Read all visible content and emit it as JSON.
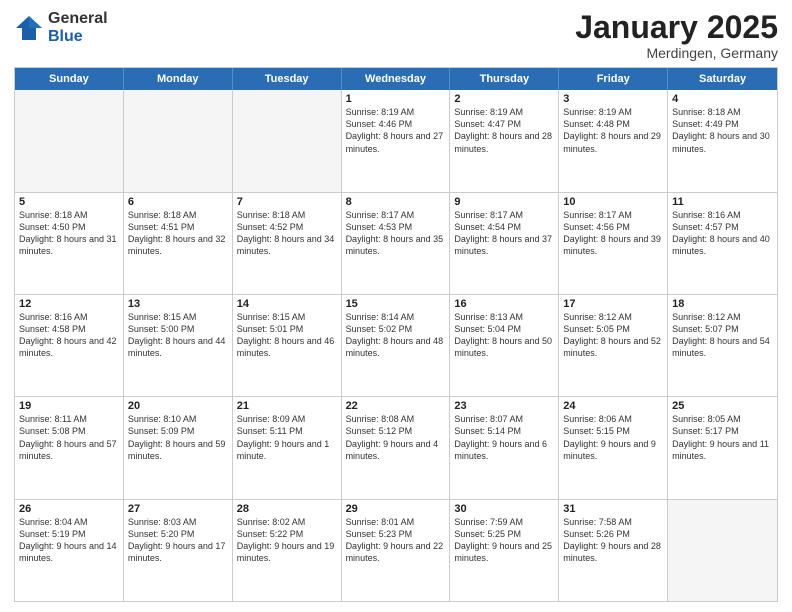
{
  "header": {
    "logo_general": "General",
    "logo_blue": "Blue",
    "month_title": "January 2025",
    "location": "Merdingen, Germany"
  },
  "weekdays": [
    "Sunday",
    "Monday",
    "Tuesday",
    "Wednesday",
    "Thursday",
    "Friday",
    "Saturday"
  ],
  "weeks": [
    [
      {
        "day": "",
        "info": "",
        "empty": true
      },
      {
        "day": "",
        "info": "",
        "empty": true
      },
      {
        "day": "",
        "info": "",
        "empty": true
      },
      {
        "day": "1",
        "info": "Sunrise: 8:19 AM\nSunset: 4:46 PM\nDaylight: 8 hours and 27 minutes."
      },
      {
        "day": "2",
        "info": "Sunrise: 8:19 AM\nSunset: 4:47 PM\nDaylight: 8 hours and 28 minutes."
      },
      {
        "day": "3",
        "info": "Sunrise: 8:19 AM\nSunset: 4:48 PM\nDaylight: 8 hours and 29 minutes."
      },
      {
        "day": "4",
        "info": "Sunrise: 8:18 AM\nSunset: 4:49 PM\nDaylight: 8 hours and 30 minutes."
      }
    ],
    [
      {
        "day": "5",
        "info": "Sunrise: 8:18 AM\nSunset: 4:50 PM\nDaylight: 8 hours and 31 minutes."
      },
      {
        "day": "6",
        "info": "Sunrise: 8:18 AM\nSunset: 4:51 PM\nDaylight: 8 hours and 32 minutes."
      },
      {
        "day": "7",
        "info": "Sunrise: 8:18 AM\nSunset: 4:52 PM\nDaylight: 8 hours and 34 minutes."
      },
      {
        "day": "8",
        "info": "Sunrise: 8:17 AM\nSunset: 4:53 PM\nDaylight: 8 hours and 35 minutes."
      },
      {
        "day": "9",
        "info": "Sunrise: 8:17 AM\nSunset: 4:54 PM\nDaylight: 8 hours and 37 minutes."
      },
      {
        "day": "10",
        "info": "Sunrise: 8:17 AM\nSunset: 4:56 PM\nDaylight: 8 hours and 39 minutes."
      },
      {
        "day": "11",
        "info": "Sunrise: 8:16 AM\nSunset: 4:57 PM\nDaylight: 8 hours and 40 minutes."
      }
    ],
    [
      {
        "day": "12",
        "info": "Sunrise: 8:16 AM\nSunset: 4:58 PM\nDaylight: 8 hours and 42 minutes."
      },
      {
        "day": "13",
        "info": "Sunrise: 8:15 AM\nSunset: 5:00 PM\nDaylight: 8 hours and 44 minutes."
      },
      {
        "day": "14",
        "info": "Sunrise: 8:15 AM\nSunset: 5:01 PM\nDaylight: 8 hours and 46 minutes."
      },
      {
        "day": "15",
        "info": "Sunrise: 8:14 AM\nSunset: 5:02 PM\nDaylight: 8 hours and 48 minutes."
      },
      {
        "day": "16",
        "info": "Sunrise: 8:13 AM\nSunset: 5:04 PM\nDaylight: 8 hours and 50 minutes."
      },
      {
        "day": "17",
        "info": "Sunrise: 8:12 AM\nSunset: 5:05 PM\nDaylight: 8 hours and 52 minutes."
      },
      {
        "day": "18",
        "info": "Sunrise: 8:12 AM\nSunset: 5:07 PM\nDaylight: 8 hours and 54 minutes."
      }
    ],
    [
      {
        "day": "19",
        "info": "Sunrise: 8:11 AM\nSunset: 5:08 PM\nDaylight: 8 hours and 57 minutes."
      },
      {
        "day": "20",
        "info": "Sunrise: 8:10 AM\nSunset: 5:09 PM\nDaylight: 8 hours and 59 minutes."
      },
      {
        "day": "21",
        "info": "Sunrise: 8:09 AM\nSunset: 5:11 PM\nDaylight: 9 hours and 1 minute."
      },
      {
        "day": "22",
        "info": "Sunrise: 8:08 AM\nSunset: 5:12 PM\nDaylight: 9 hours and 4 minutes."
      },
      {
        "day": "23",
        "info": "Sunrise: 8:07 AM\nSunset: 5:14 PM\nDaylight: 9 hours and 6 minutes."
      },
      {
        "day": "24",
        "info": "Sunrise: 8:06 AM\nSunset: 5:15 PM\nDaylight: 9 hours and 9 minutes."
      },
      {
        "day": "25",
        "info": "Sunrise: 8:05 AM\nSunset: 5:17 PM\nDaylight: 9 hours and 11 minutes."
      }
    ],
    [
      {
        "day": "26",
        "info": "Sunrise: 8:04 AM\nSunset: 5:19 PM\nDaylight: 9 hours and 14 minutes."
      },
      {
        "day": "27",
        "info": "Sunrise: 8:03 AM\nSunset: 5:20 PM\nDaylight: 9 hours and 17 minutes."
      },
      {
        "day": "28",
        "info": "Sunrise: 8:02 AM\nSunset: 5:22 PM\nDaylight: 9 hours and 19 minutes."
      },
      {
        "day": "29",
        "info": "Sunrise: 8:01 AM\nSunset: 5:23 PM\nDaylight: 9 hours and 22 minutes."
      },
      {
        "day": "30",
        "info": "Sunrise: 7:59 AM\nSunset: 5:25 PM\nDaylight: 9 hours and 25 minutes."
      },
      {
        "day": "31",
        "info": "Sunrise: 7:58 AM\nSunset: 5:26 PM\nDaylight: 9 hours and 28 minutes."
      },
      {
        "day": "",
        "info": "",
        "empty": true
      }
    ]
  ]
}
